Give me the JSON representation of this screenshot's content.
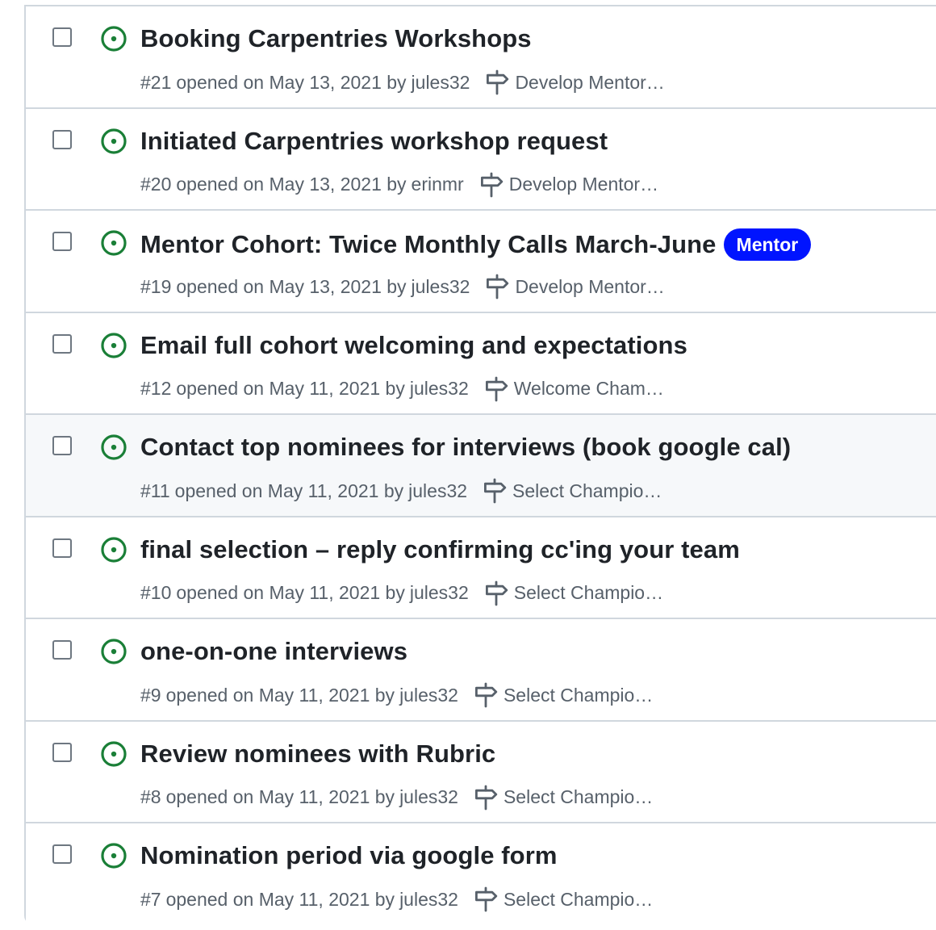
{
  "colors": {
    "open_icon": "#1a7f37",
    "label_mentor": "#0014ff"
  },
  "issues": [
    {
      "title": "Booking Carpentries Workshops",
      "number": "#21",
      "opened": "opened on May 13, 2021 by",
      "author": "jules32",
      "milestone": "Develop Mentor…",
      "label": ""
    },
    {
      "title": "Initiated Carpentries workshop request",
      "number": "#20",
      "opened": "opened on May 13, 2021 by",
      "author": "erinmr",
      "milestone": "Develop Mentor…",
      "label": ""
    },
    {
      "title": "Mentor Cohort: Twice Monthly Calls March-June",
      "number": "#19",
      "opened": "opened on May 13, 2021 by",
      "author": "jules32",
      "milestone": "Develop Mentor…",
      "label": "Mentor"
    },
    {
      "title": "Email full cohort welcoming and expectations",
      "number": "#12",
      "opened": "opened on May 11, 2021 by",
      "author": "jules32",
      "milestone": "Welcome Cham…",
      "label": ""
    },
    {
      "title": "Contact top nominees for interviews (book google cal)",
      "number": "#11",
      "opened": "opened on May 11, 2021 by",
      "author": "jules32",
      "milestone": "Select Champio…",
      "label": ""
    },
    {
      "title": "final selection – reply confirming cc'ing your team",
      "number": "#10",
      "opened": "opened on May 11, 2021 by",
      "author": "jules32",
      "milestone": "Select Champio…",
      "label": ""
    },
    {
      "title": "one-on-one interviews",
      "number": "#9",
      "opened": "opened on May 11, 2021 by",
      "author": "jules32",
      "milestone": "Select Champio…",
      "label": ""
    },
    {
      "title": "Review nominees with Rubric",
      "number": "#8",
      "opened": "opened on May 11, 2021 by",
      "author": "jules32",
      "milestone": "Select Champio…",
      "label": ""
    },
    {
      "title": "Nomination period via google form",
      "number": "#7",
      "opened": "opened on May 11, 2021 by",
      "author": "jules32",
      "milestone": "Select Champio…",
      "label": ""
    }
  ]
}
